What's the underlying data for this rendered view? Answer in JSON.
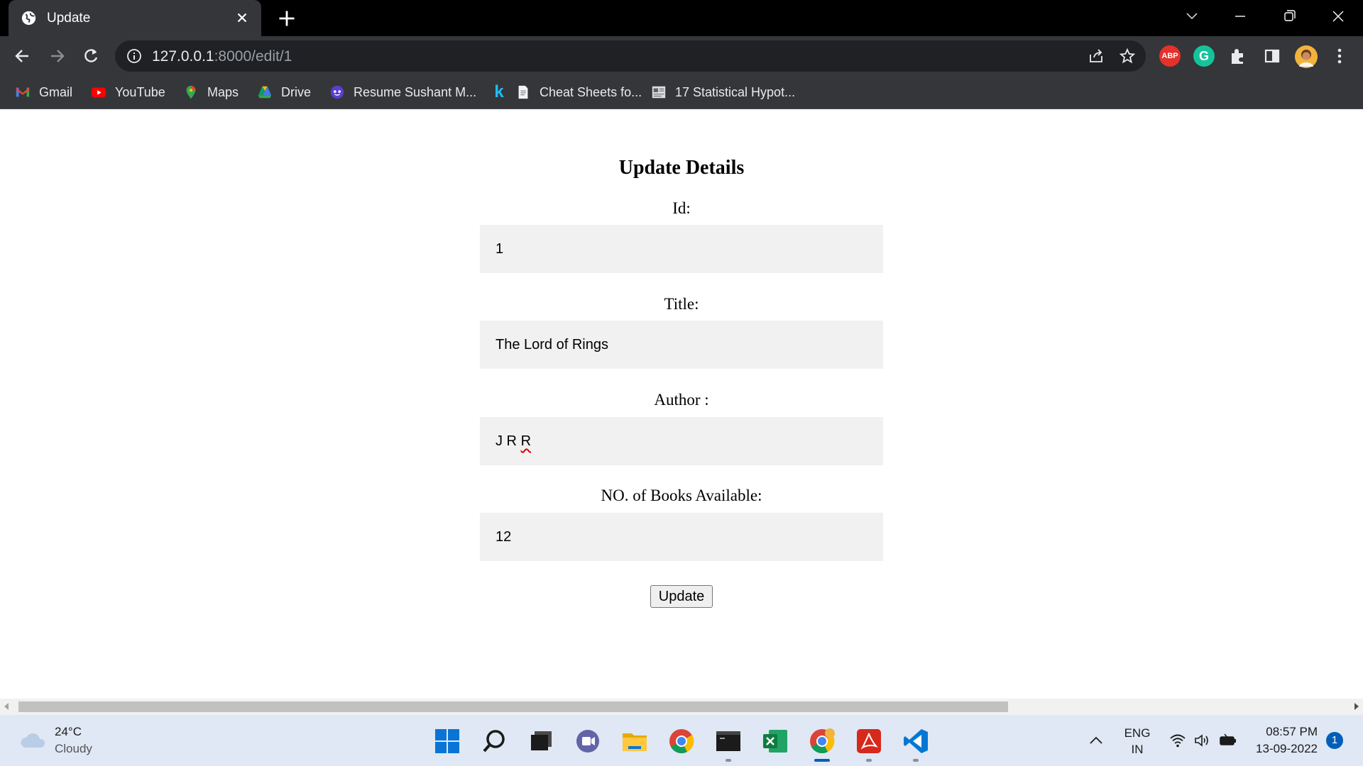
{
  "browser": {
    "tab_title": "Update",
    "url_host": "127.0.0.1",
    "url_path": ":8000/edit/1",
    "bookmarks": [
      {
        "label": "Gmail",
        "icon": "gmail-icon"
      },
      {
        "label": "YouTube",
        "icon": "youtube-icon"
      },
      {
        "label": "Maps",
        "icon": "maps-icon"
      },
      {
        "label": "Drive",
        "icon": "drive-icon"
      },
      {
        "label": "Resume Sushant M...",
        "icon": "resume-icon"
      },
      {
        "label": "",
        "icon": "k-icon"
      },
      {
        "label": "Cheat Sheets fo...",
        "icon": "document-icon"
      },
      {
        "label": "17 Statistical Hypot...",
        "icon": "image-icon"
      }
    ],
    "extensions": {
      "abp": "ABP",
      "grammarly": "G"
    }
  },
  "form": {
    "heading": "Update Details",
    "fields": [
      {
        "label": "Id:",
        "value": "1"
      },
      {
        "label": "Title:",
        "value": "The Lord of Rings"
      },
      {
        "label": "Author :",
        "value_a": "J R ",
        "value_b": "R"
      },
      {
        "label": "NO. of Books Available:",
        "value": "12"
      }
    ],
    "submit_label": "Update"
  },
  "taskbar": {
    "weather_temp": "24°C",
    "weather_cond": "Cloudy",
    "lang_1": "ENG",
    "lang_2": "IN",
    "time": "08:57 PM",
    "date": "13-09-2022",
    "notification_count": "1"
  },
  "colors": {
    "tab_bg": "#35363a",
    "omnibox_bg": "#202124",
    "field_bg": "#f1f1f1",
    "taskbar_bg": "#dfe8f4",
    "accent": "#005fb8"
  }
}
